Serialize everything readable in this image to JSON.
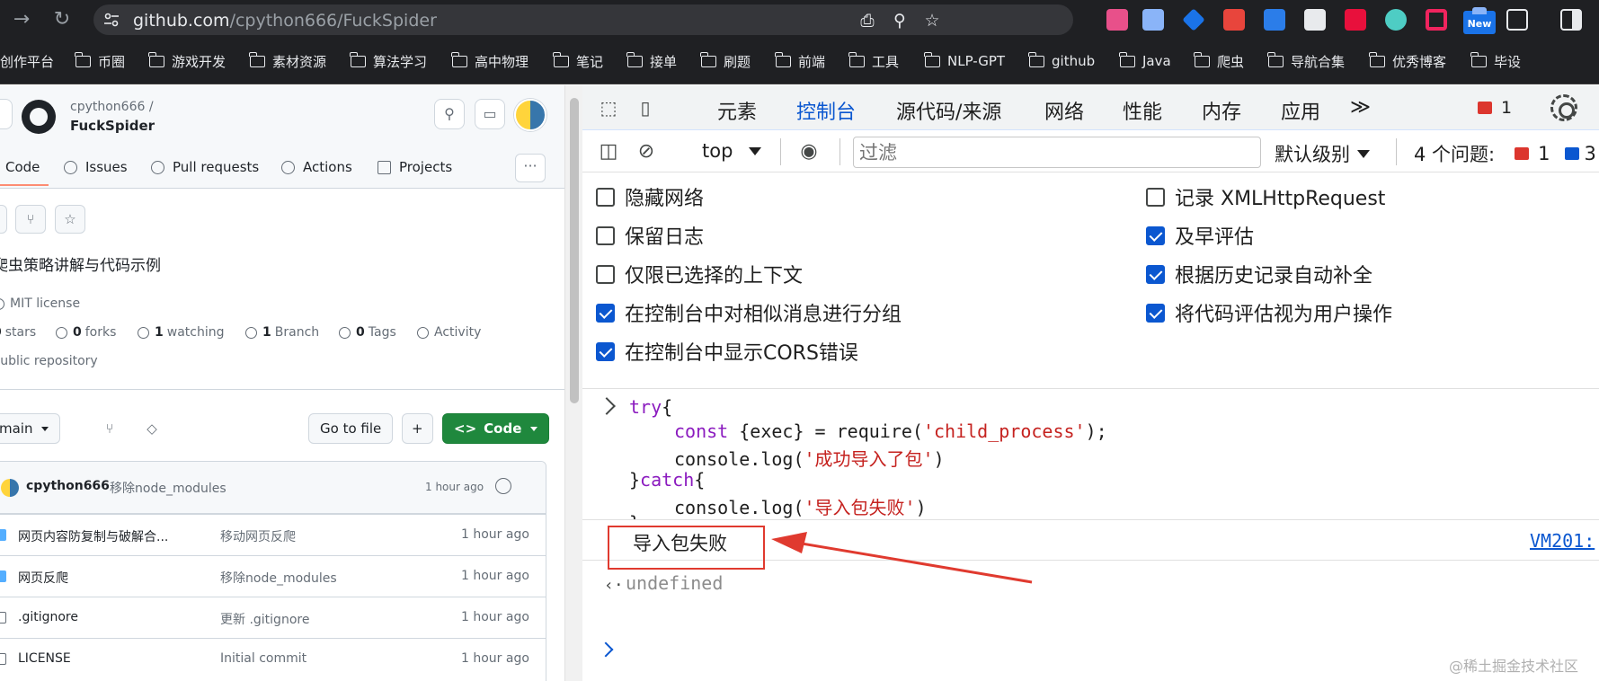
{
  "browser": {
    "url_host": "github.com",
    "url_path": "/cpython666/FuckSpider",
    "bookmarks": [
      "创作平台",
      "币圈",
      "游戏开发",
      "素材资源",
      "算法学习",
      "高中物理",
      "笔记",
      "接单",
      "刷题",
      "前端",
      "工具",
      "NLP-GPT",
      "github",
      "Java",
      "爬虫",
      "导航合集",
      "优秀博客",
      "毕设"
    ],
    "new_badge": "New"
  },
  "github": {
    "owner": "cpython666 /",
    "repo": "FuckSpider",
    "tabs": [
      "Code",
      "Issues",
      "Pull requests",
      "Actions",
      "Projects"
    ],
    "more": "···",
    "description": "爬虫策略讲解与代码示例",
    "license": "MIT license",
    "stats": [
      {
        "count": "0",
        "label": "stars"
      },
      {
        "count": "0",
        "label": "forks"
      },
      {
        "count": "1",
        "label": "watching"
      },
      {
        "count": "1",
        "label": "Branch"
      },
      {
        "count": "0",
        "label": "Tags"
      },
      {
        "count": "",
        "label": "Activity"
      }
    ],
    "visibility": "Public repository",
    "branch": "main",
    "goto_file": "Go to file",
    "add": "+",
    "code_button": "Code",
    "latest_commit": {
      "author": "cpython666",
      "message": "移除node_modules",
      "time": "1 hour ago"
    },
    "files": [
      {
        "type": "dir",
        "name": "网页内容防复制与破解合...",
        "message": "移动网页反爬",
        "time": "1 hour ago"
      },
      {
        "type": "dir",
        "name": "网页反爬",
        "message": "移除node_modules",
        "time": "1 hour ago"
      },
      {
        "type": "file",
        "name": ".gitignore",
        "message": "更新 .gitignore",
        "time": "1 hour ago"
      },
      {
        "type": "file",
        "name": "LICENSE",
        "message": "Initial commit",
        "time": "1 hour ago"
      }
    ]
  },
  "devtools": {
    "tabs": [
      "元素",
      "控制台",
      "源代码/来源",
      "网络",
      "性能",
      "内存",
      "应用"
    ],
    "more_tabs": "≫",
    "error_count": "1",
    "context": "top",
    "filter_placeholder": "过滤",
    "level": "默认级别",
    "issues_label": "4 个问题:",
    "issues_errors": "1",
    "issues_messages": "3",
    "settings_left": [
      {
        "label": "隐藏网络",
        "checked": false
      },
      {
        "label": "保留日志",
        "checked": false
      },
      {
        "label": "仅限已选择的上下文",
        "checked": false
      },
      {
        "label": "在控制台中对相似消息进行分组",
        "checked": true
      },
      {
        "label": "在控制台中显示CORS错误",
        "checked": true
      }
    ],
    "settings_right": [
      {
        "label": "记录 XMLHttpRequest",
        "checked": false
      },
      {
        "label": "及早评估",
        "checked": true
      },
      {
        "label": "根据历史记录自动补全",
        "checked": true
      },
      {
        "label": "将代码评估视为用户操作",
        "checked": true
      }
    ],
    "code": {
      "l1_kw": "try",
      "l1_rest": "{",
      "l2_kw": "const",
      "l2_mid": " {exec} = require(",
      "l2_str": "'child_process'",
      "l2_end": ");",
      "l3_a": "console.log(",
      "l3_str": "'成功导入了包'",
      "l3_end": ")",
      "l4_a": "}",
      "l4_kw": "catch",
      "l4_b": "{",
      "l5_a": "console.log(",
      "l5_str": "'导入包失败'",
      "l5_end": ")",
      "l6": "}"
    },
    "output": "导入包失败",
    "output_source": "VM201:",
    "result": "undefined",
    "colors": {
      "accent": "#0b57d0",
      "annotation": "#e03a2f"
    }
  },
  "watermark": "@稀土掘金技术社区"
}
